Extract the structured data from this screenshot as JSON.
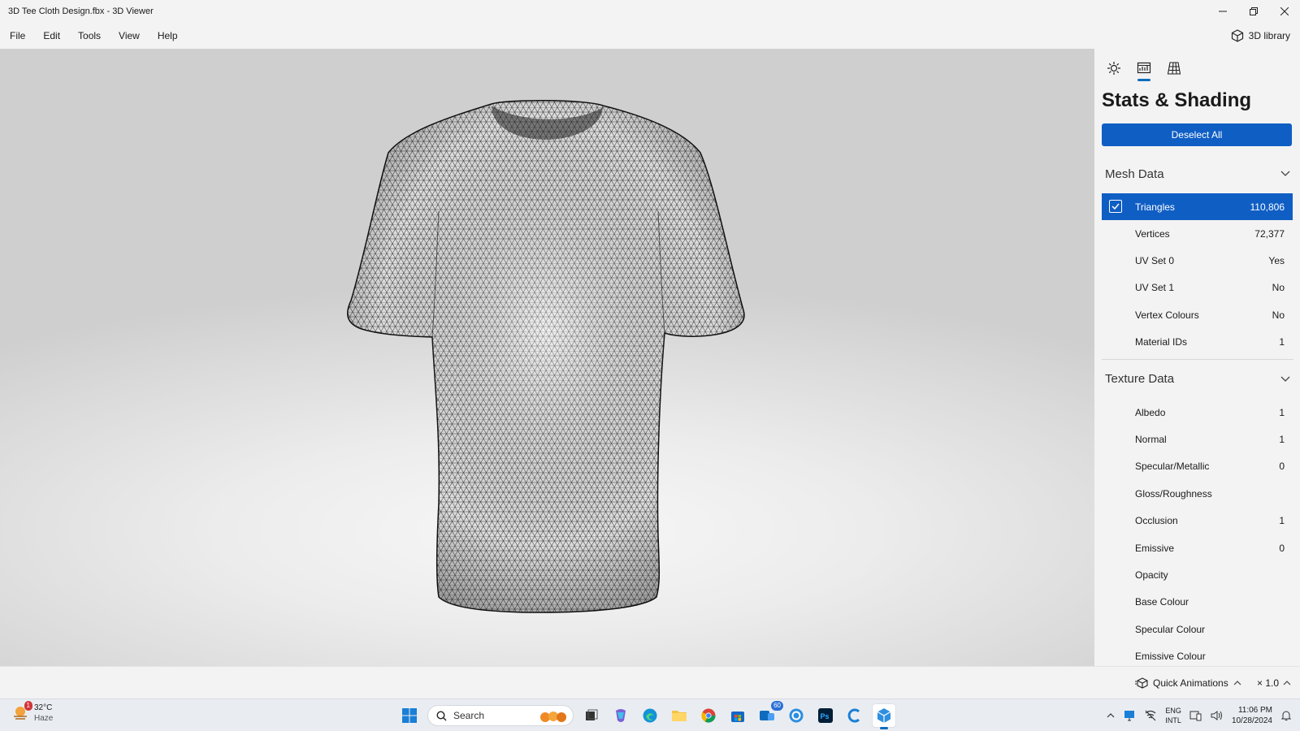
{
  "window": {
    "title": "3D Tee Cloth Design.fbx - 3D Viewer",
    "minimize_icon": "minimize-icon",
    "restore_icon": "restore-icon",
    "close_icon": "close-icon"
  },
  "menu": {
    "items": [
      "File",
      "Edit",
      "Tools",
      "View",
      "Help"
    ],
    "library_label": "3D library"
  },
  "panel": {
    "tabs": [
      "lighting-icon",
      "stats-icon",
      "grid-icon"
    ],
    "active_tab": 1,
    "title": "Stats & Shading",
    "deselect_label": "Deselect All",
    "mesh_section": "Mesh Data",
    "mesh_rows": [
      {
        "label": "Triangles",
        "value": "110,806"
      },
      {
        "label": "Vertices",
        "value": "72,377"
      },
      {
        "label": "UV Set 0",
        "value": "Yes"
      },
      {
        "label": "UV Set 1",
        "value": "No"
      },
      {
        "label": "Vertex Colours",
        "value": "No"
      },
      {
        "label": "Material IDs",
        "value": "1"
      }
    ],
    "texture_section": "Texture Data",
    "texture_rows": [
      {
        "label": "Albedo",
        "value": "1"
      },
      {
        "label": "Normal",
        "value": "1"
      },
      {
        "label": "Specular/Metallic",
        "value": "0"
      },
      {
        "label": "Gloss/Roughness",
        "value": ""
      },
      {
        "label": "Occlusion",
        "value": "1"
      },
      {
        "label": "Emissive",
        "value": "0"
      },
      {
        "label": "Opacity",
        "value": ""
      },
      {
        "label": "Base Colour",
        "value": ""
      },
      {
        "label": "Specular Colour",
        "value": ""
      },
      {
        "label": "Emissive Colour",
        "value": ""
      }
    ]
  },
  "statusbar": {
    "quick_animations": "Quick Animations",
    "speed": "× 1.0"
  },
  "taskbar": {
    "weather_temp": "32°C",
    "weather_cond": "Haze",
    "weather_badge": "1",
    "search_placeholder": "Search",
    "teams_badge": "60",
    "lang_top": "ENG",
    "lang_bottom": "INTL",
    "time": "11:06 PM",
    "date": "10/28/2024"
  },
  "colors": {
    "accent": "#0f5ec4",
    "panel_bg": "#f3f3f3"
  }
}
